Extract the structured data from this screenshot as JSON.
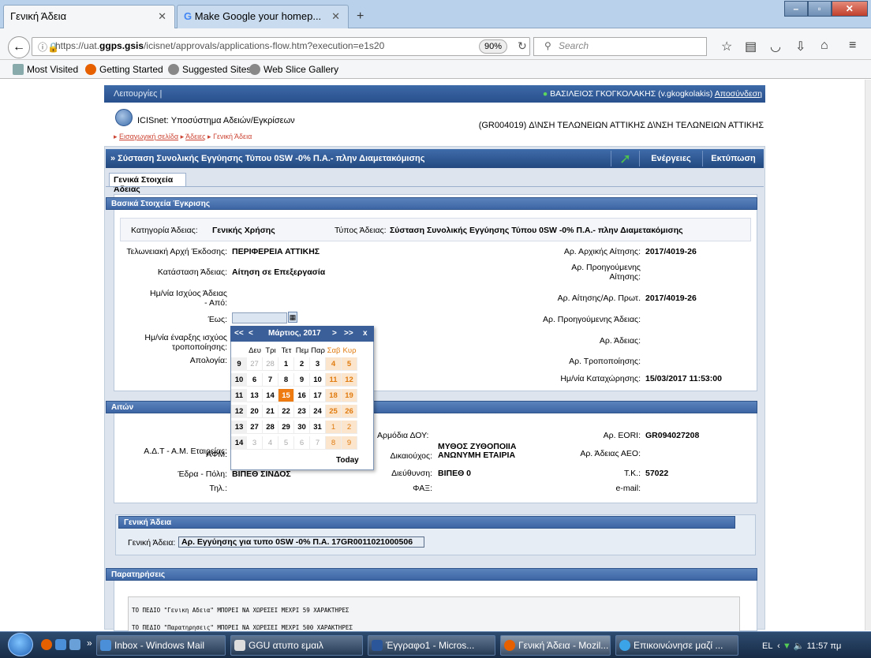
{
  "browser": {
    "tabs": [
      {
        "label": "Γενική Άδεια"
      },
      {
        "label": "Make Google your homep..."
      }
    ],
    "url_prefix": "https://uat.",
    "url_host": "ggps.gsis",
    "url_rest": "/icisnet/approvals/applications-flow.htm?execution=e1s20",
    "zoom": "90%",
    "search_placeholder": "Search",
    "bookmarks": [
      "Most Visited",
      "Getting Started",
      "Suggested Sites",
      "Web Slice Gallery"
    ]
  },
  "app": {
    "menu_label": "Λειτουργίες",
    "user": "ΒΑΣΙΛΕΙΟΣ ΓΚΟΓΚΟΛΑΚΗΣ (v.gkogkolakis)",
    "logout": "Αποσύνδεση",
    "subsystem": "ICISnet: Υποσύστημα Αδειών/Εγκρίσεων",
    "office": "(GR004019) Δ\\ΝΣΗ ΤΕΛΩΝΕΙΩΝ ΑΤΤΙΚΗΣ Δ\\ΝΣΗ ΤΕΛΩΝΕΙΩΝ ΑΤΤΙΚΗΣ",
    "breadcrumbs": [
      "Εισαγωγική σελίδα",
      "Άδειες",
      "Γενική Άδεια"
    ],
    "page_title": "» Σύσταση Συνολικής Εγγύησης Τύπου 0SW -0% Π.Α.- πλην Διαμετακόμισης",
    "actions_label": "Ενέργειες",
    "print_label": "Εκτύπωση",
    "tab_label": "Γενικά Στοιχεία Άδειας"
  },
  "basic": {
    "header": "Βασικά Στοιχεία Έγκρισης",
    "category_label": "Κατηγορία Άδειας:",
    "category_value": "Γενικής Χρήσης",
    "type_label": "Τύπος Άδειας:",
    "type_value": "Σύσταση Συνολικής Εγγύησης Τύπου 0SW -0% Π.Α.- πλην Διαμετακόμισης",
    "customs_label": "Τελωνειακή Αρχή Έκδοσης:",
    "customs_value": "ΠΕΡΙΦΕΡΕΙΑ ΑΤΤΙΚΗΣ",
    "status_label": "Κατάσταση Άδειας:",
    "status_value": "Αίτηση σε Επεξεργασία",
    "valid_from_label": "Ημ/νία Ισχύος Άδειας - Από:",
    "valid_to_label": "Έως:",
    "mod_start_label": "Ημ/νία έναρξης ισχύος τροποποίησης:",
    "justification_label": "Απολογία:",
    "initial_app_label": "Αρ. Αρχικής Αίτησης:",
    "initial_app_value": "2017/4019-26",
    "prev_app_label": "Αρ. Προηγούμενης Αίτησης:",
    "app_no_label": "Αρ. Αίτησης/Αρ. Πρωτ.",
    "app_no_value": "2017/4019-26",
    "prev_permit_label": "Αρ. Προηγούμενης Άδειας:",
    "permit_no_label": "Αρ. Άδειας:",
    "mod_no_label": "Αρ. Τροποποίησης:",
    "reg_date_label": "Ημ/νία Καταχώρησης:",
    "reg_date_value": "15/03/2017 11:53:00"
  },
  "calendar": {
    "prev_year": "<<",
    "prev_month": "<",
    "title": "Μάρτιος, 2017",
    "next_month": ">",
    "next_year": ">>",
    "close": "x",
    "weekdays": [
      "Δευ",
      "Τρι",
      "Τετ",
      "Πεμ",
      "Παρ",
      "Σαβ",
      "Κυρ"
    ],
    "weeks": [
      {
        "wk": "9",
        "days": [
          "27",
          "28",
          "1",
          "2",
          "3",
          "4",
          "5"
        ]
      },
      {
        "wk": "10",
        "days": [
          "6",
          "7",
          "8",
          "9",
          "10",
          "11",
          "12"
        ]
      },
      {
        "wk": "11",
        "days": [
          "13",
          "14",
          "15",
          "16",
          "17",
          "18",
          "19"
        ]
      },
      {
        "wk": "12",
        "days": [
          "20",
          "21",
          "22",
          "23",
          "24",
          "25",
          "26"
        ]
      },
      {
        "wk": "13",
        "days": [
          "27",
          "28",
          "29",
          "30",
          "31",
          "1",
          "2"
        ]
      },
      {
        "wk": "14",
        "days": [
          "3",
          "4",
          "5",
          "6",
          "7",
          "8",
          "9"
        ]
      }
    ],
    "selected": "15",
    "today_label": "Today"
  },
  "applicant": {
    "header": "Αιτών",
    "afm_label": "ΑΦΜ:",
    "adt_label": "Α.Δ.Τ - Α.Μ. Εταιρείας:",
    "seat_label": "Έδρα - Πόλη:",
    "seat_value": "ΒΙΠΕΘ ΣΙΝΔΟΣ",
    "phone_label": "Τηλ.:",
    "doy_label": "Αρμόδια ΔΟΥ:",
    "beneficiary_label": "Δικαιούχος:",
    "beneficiary_value": "ΜΥΘΟΣ ΖΥΘΟΠΟΙΙΑ ΑΝΩΝΥΜΗ ΕΤΑΙΡΙΑ",
    "address_label": "Διεύθυνση:",
    "address_value": "ΒΙΠΕΘ 0",
    "fax_label": "ΦΑΞ:",
    "eori_label": "Αρ. EORI:",
    "eori_value": "GR094027208",
    "aeo_label": "Αρ. Άδειας ΑΕΟ:",
    "tk_label": "Τ.Κ.:",
    "tk_value": "57022",
    "email_label": "e-mail:"
  },
  "general": {
    "header": "Γενική Άδεια",
    "label": "Γενική Άδεια:",
    "value": "Αρ. Εγγύησης για τυπο 0SW -0% Π.Α.  17GR0011021000506"
  },
  "remarks": {
    "header": "Παρατηρήσεις",
    "line1": "ΤΟ ΠΕΔΙΟ \"Γενικη Αδεια\" ΜΠΟΡΕΙ ΝΑ ΧΩΡΕΣΕΙ ΜΕΧΡΙ 59 ΧΑΡΑΚΤΗΡΕΣ",
    "line2": "ΤΟ ΠΕΔΙΟ \"Παρατηρησεις\"  ΜΠΟΡΕΙ ΝΑ ΧΩΡΕΣΕΙ ΜΕΧΡΙ 500 ΧΑΡΑΚΤΗΡΕΣ"
  },
  "taskbar": {
    "items": [
      "Inbox - Windows Mail",
      "GGU ατυπο εμαιλ",
      "Έγγραφο1 - Micros...",
      "Γενική Άδεια - Mozil...",
      "Επικοινώνησε μαζί ..."
    ],
    "lang": "EL",
    "time": "11:57 πμ"
  },
  "colors": {
    "header_blue": "#3a5f99",
    "today_orange": "#ee7b12",
    "weekend": "#e07b10"
  }
}
